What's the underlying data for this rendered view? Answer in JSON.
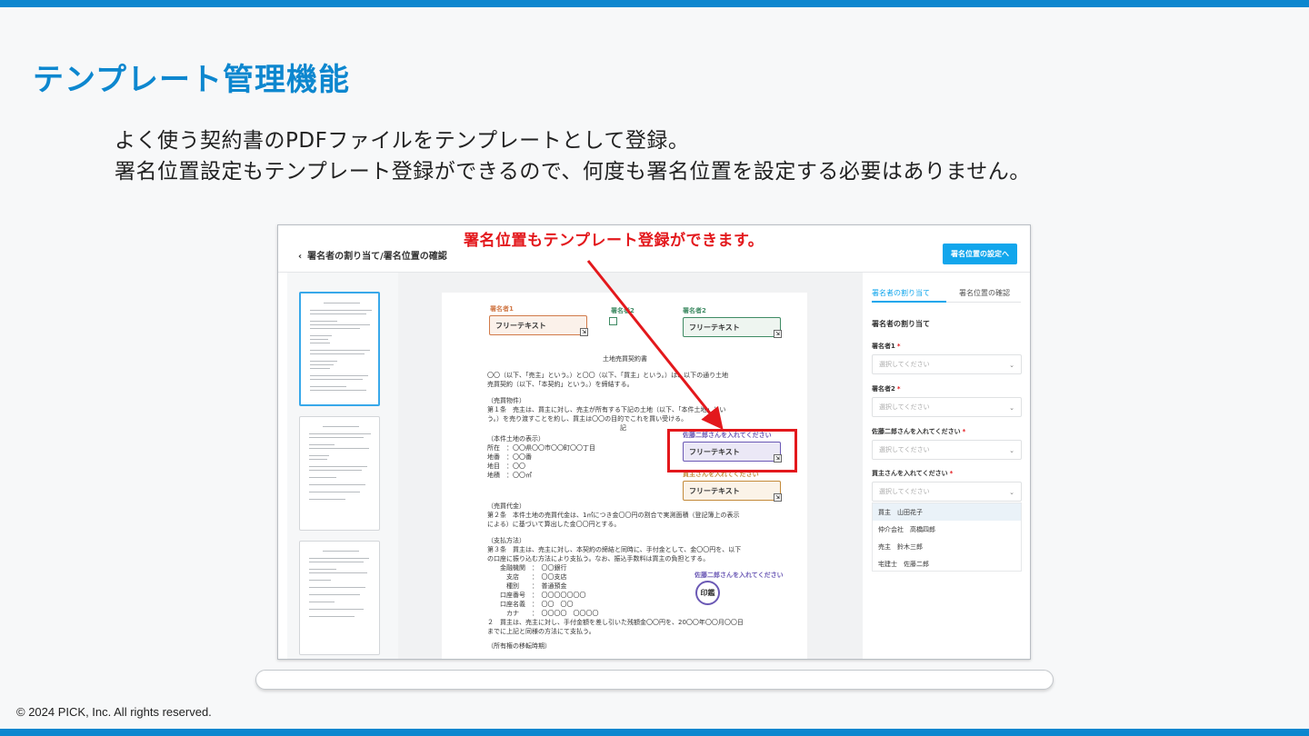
{
  "slide": {
    "title": "テンプレート管理機能",
    "lead_line1": "よく使う契約書のPDFファイルをテンプレートとして登録。",
    "lead_line2": "署名位置設定もテンプレート登録ができるので、何度も署名位置を設定する必要はありません。",
    "copyright": "© 2024 PICK, Inc. All rights reserved.",
    "callout": "署名位置もテンプレート登録ができます。",
    "accent_color": "#0d87cf",
    "callout_color": "#e3181c"
  },
  "app": {
    "header": {
      "back_label": "署名者の割り当て/署名位置の確認",
      "next_button": "署名位置の設定へ"
    },
    "pdf": {
      "signer1_label": "署名者1",
      "signer2_label": "署名者2",
      "signer2_check_label": "署名者2",
      "field_text": "フリーテキスト",
      "sato_label": "佐藤二郎さんを入れてください",
      "buyer_label": "買主さんを入れてください",
      "sato_stamp_label": "佐藤二郎さんを入れてください",
      "stamp_text": "印鑑",
      "doc_title": "土地売買契約書",
      "doc_block1": "〇〇（以下、「売主」という。）と〇〇（以下、「買主」という。）は、以下の通り土地\n売買契約（以下、「本契約」という。）を締結する。",
      "doc_block2": "（売買物件）\n第１条　売主は、買主に対し、売主が所有する下記の土地（以下、「本件土地」とい\nう。）を売り渡すことを約し、買主は〇〇の目的でこれを買い受ける。",
      "doc_ki": "記",
      "doc_block3": "（本件土地の表示）\n所在　：〇〇県〇〇市〇〇町〇〇丁目\n地番　：〇〇番\n地目　：〇〇\n地積　：〇〇㎡",
      "doc_block4": "（売買代金）\n第２条　本件土地の売買代金は、1㎡につき金〇〇円の割合で実測面積（登記簿上の表示\nによる）に基づいて算出した金〇〇円とする。",
      "doc_block5": "（支払方法）\n第３条　買主は、売主に対し、本契約の締結と同時に、手付金として、金〇〇円を、以下\nの口座に振り込む方法により支払う。なお、振込手数料は買主の負担とする。\n　　金融機関　：　〇〇銀行\n　　　支店　　：　〇〇支店\n　　　種別　　：　普通預金\n　　口座番号　：　〇〇〇〇〇〇〇\n　　口座名義　：　〇〇　〇〇\n　　　カナ　　：　〇〇〇〇　〇〇〇〇\n２　買主は、売主に対し、手付金額を差し引いた残額金〇〇円を、20〇〇年〇〇月〇〇日\nまでに上記と同様の方法にて支払う。",
      "doc_block6": "（所有権の移転時期）"
    },
    "sidebar": {
      "tab_assign": "署名者の割り当て",
      "tab_confirm": "署名位置の確認",
      "heading": "署名者の割り当て",
      "fields": [
        {
          "label": "署名者1",
          "placeholder": "選択してください"
        },
        {
          "label": "署名者2",
          "placeholder": "選択してください"
        },
        {
          "label": "佐藤二郎さんを入れてください",
          "placeholder": "選択してください"
        },
        {
          "label": "買主さんを入れてください",
          "placeholder": "選択してください"
        }
      ],
      "options": [
        "買主　山田花子",
        "仲介会社　高橋四郎",
        "売主　鈴木三郎",
        "宅建士　佐藤二郎"
      ],
      "brand_color": "#12a6ec"
    }
  }
}
